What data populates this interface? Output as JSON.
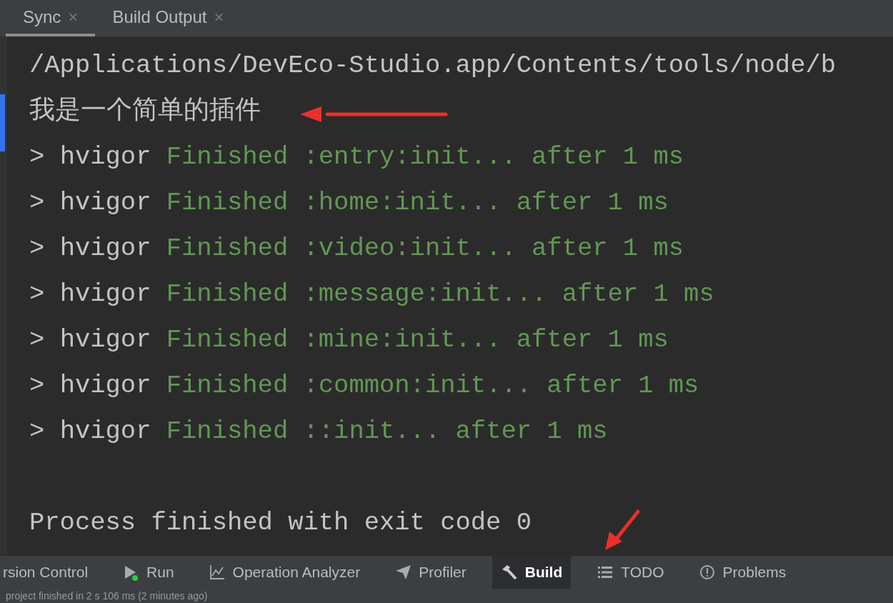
{
  "tabs": [
    {
      "label": "Sync",
      "selected": true,
      "close": "×"
    },
    {
      "label": "Build Output",
      "selected": false,
      "close": "×"
    }
  ],
  "console": [
    {
      "kind": "plain",
      "text": "/Applications/DevEco-Studio.app/Contents/tools/node/b"
    },
    {
      "kind": "plain",
      "text": "我是一个简单的插件"
    },
    {
      "kind": "task",
      "prompt": ">",
      "tool": "hvigor",
      "status": "Finished",
      "task": ":entry:init...",
      "after": "after 1 ms"
    },
    {
      "kind": "task",
      "prompt": ">",
      "tool": "hvigor",
      "status": "Finished",
      "task": ":home:init...",
      "after": "after 1 ms"
    },
    {
      "kind": "task",
      "prompt": ">",
      "tool": "hvigor",
      "status": "Finished",
      "task": ":video:init...",
      "after": "after 1 ms"
    },
    {
      "kind": "task",
      "prompt": ">",
      "tool": "hvigor",
      "status": "Finished",
      "task": ":message:init...",
      "after": "after 1 ms"
    },
    {
      "kind": "task",
      "prompt": ">",
      "tool": "hvigor",
      "status": "Finished",
      "task": ":mine:init...",
      "after": "after 1 ms"
    },
    {
      "kind": "task",
      "prompt": ">",
      "tool": "hvigor",
      "status": "Finished",
      "task": ":common:init...",
      "after": "after 1 ms"
    },
    {
      "kind": "task",
      "prompt": ">",
      "tool": "hvigor",
      "status": "Finished",
      "task": "::init...",
      "after": "after 1 ms"
    },
    {
      "kind": "blank"
    },
    {
      "kind": "plain",
      "text": "Process finished with exit code 0"
    }
  ],
  "toolbar": [
    {
      "label": "rsion Control",
      "kind": "none",
      "selected": false
    },
    {
      "label": "Run",
      "kind": "run",
      "selected": false
    },
    {
      "label": "Operation Analyzer",
      "kind": "chart",
      "selected": false
    },
    {
      "label": "Profiler",
      "kind": "profiler",
      "selected": false
    },
    {
      "label": "Build",
      "kind": "hammer",
      "selected": true
    },
    {
      "label": "TODO",
      "kind": "list",
      "selected": false
    },
    {
      "label": "Problems",
      "kind": "problems",
      "selected": false
    }
  ],
  "status_bar": "project finished in 2 s 106 ms (2 minutes ago)"
}
